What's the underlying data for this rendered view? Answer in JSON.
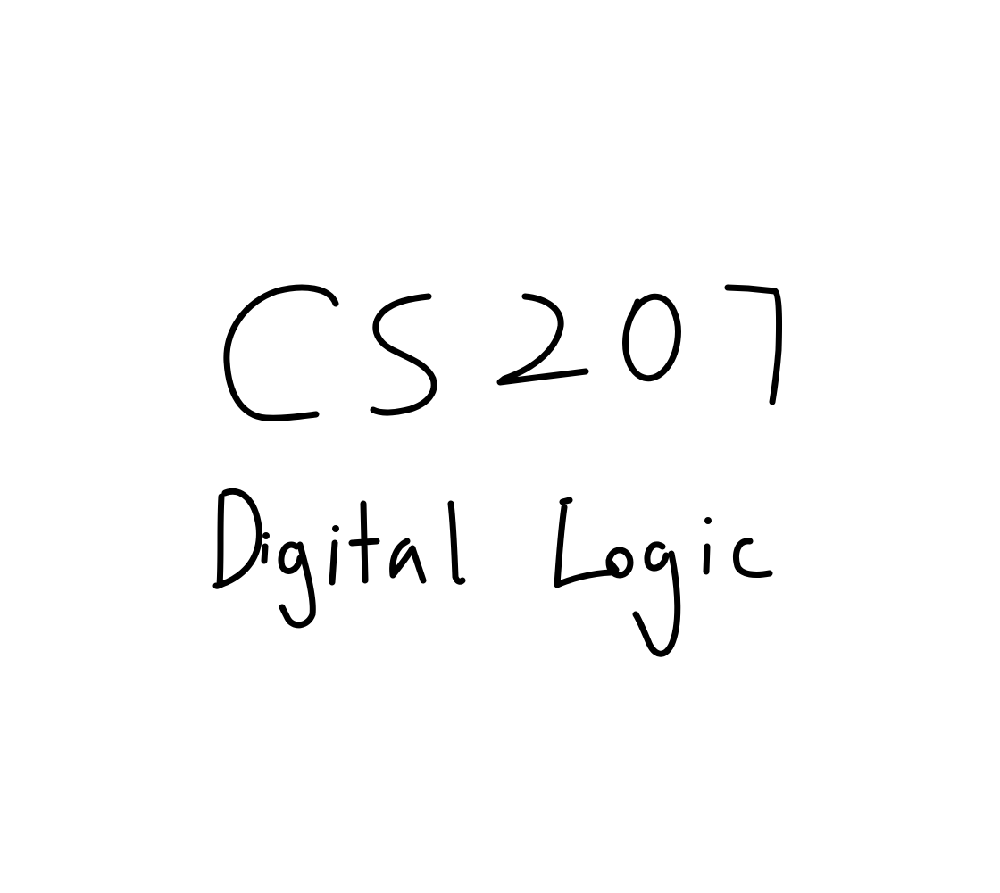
{
  "slide": {
    "title": "CS207",
    "subtitle": "Digital Logic",
    "ink_color": "#000000",
    "background_color": "#ffffff"
  }
}
